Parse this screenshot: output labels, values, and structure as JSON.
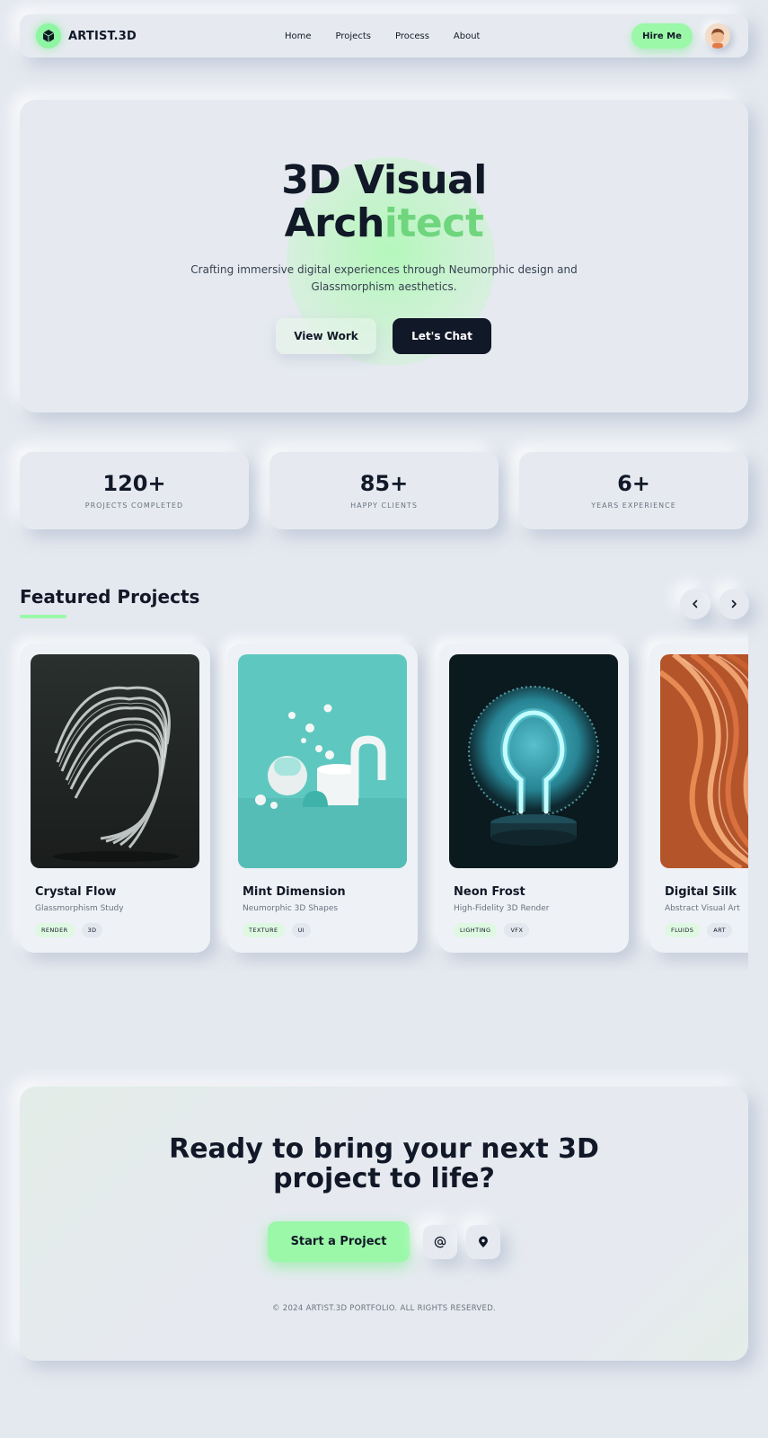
{
  "nav": {
    "brand": "ARTIST.3D",
    "links": [
      "Home",
      "Projects",
      "Process",
      "About"
    ],
    "hire_label": "Hire Me"
  },
  "hero": {
    "title_line1": "3D Visual",
    "title_line2_start": "Arch",
    "title_line2_accent": "itect",
    "subtitle": "Crafting immersive digital experiences through Neumorphic design and Glassmorphism aesthetics.",
    "btn_view": "View Work",
    "btn_chat": "Let's Chat"
  },
  "stats": [
    {
      "value": "120+",
      "label": "PROJECTS COMPLETED"
    },
    {
      "value": "85+",
      "label": "HAPPY CLIENTS"
    },
    {
      "value": "6+",
      "label": "YEARS EXPERIENCE"
    }
  ],
  "featured": {
    "title": "Featured Projects",
    "cards": [
      {
        "title": "Crystal Flow",
        "subtitle": "Glassmorphism Study",
        "tags": [
          "RENDER",
          "3D"
        ]
      },
      {
        "title": "Mint Dimension",
        "subtitle": "Neumorphic 3D Shapes",
        "tags": [
          "TEXTURE",
          "UI"
        ]
      },
      {
        "title": "Neon Frost",
        "subtitle": "High-Fidelity 3D Render",
        "tags": [
          "LIGHTING",
          "VFX"
        ]
      },
      {
        "title": "Digital Silk",
        "subtitle": "Abstract Visual Art",
        "tags": [
          "FLUIDS",
          "ART"
        ]
      }
    ]
  },
  "cta": {
    "title_line1": "Ready to bring your next 3D",
    "title_line2": "project to life?",
    "start_label": "Start a Project",
    "copyright": "© 2024 ARTIST.3D PORTFOLIO. ALL RIGHTS RESERVED."
  },
  "icons": {
    "logo": "cube-icon",
    "prev": "chevron-left-icon",
    "next": "chevron-right-icon",
    "email": "at-sign-icon",
    "location": "map-pin-icon"
  },
  "colors": {
    "background": "#e4e8ef",
    "accent": "#9af8a8",
    "dark": "#111827"
  }
}
